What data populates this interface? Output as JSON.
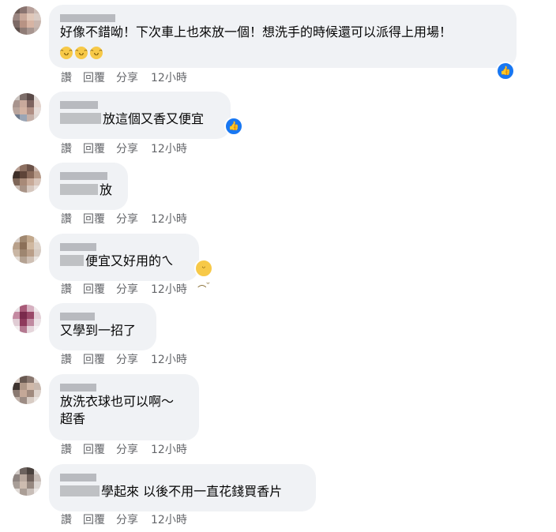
{
  "actions": {
    "read": "讚",
    "reply": "回覆",
    "share": "分享"
  },
  "comments": [
    {
      "text": "好像不錯呦！下次車上也來放一個！想洗手的時候還可以派得上用場！",
      "time": "12小時",
      "like_icon": "thumbs-up-icon",
      "emojis": [
        "😆",
        "😆",
        "😆"
      ]
    },
    {
      "text": "放這個又香又便宜",
      "time": "12小時",
      "like_icon": "thumbs-up-icon"
    },
    {
      "text": "放",
      "time": "12小時"
    },
    {
      "text": "便宜又好用的ㄟ",
      "time": "12小時",
      "reaction_icon": "sad-face-icon"
    },
    {
      "text": "又學到一招了",
      "time": "12小時"
    },
    {
      "text": "放洗衣球也可以啊～",
      "text2": "超香",
      "time": "12小時"
    },
    {
      "text": "學起來 以後不用一直花錢買香片",
      "time": "12小時"
    }
  ],
  "colors": {
    "bubble": "#f0f2f5",
    "like": "#1877f2",
    "meta": "#65676b"
  }
}
